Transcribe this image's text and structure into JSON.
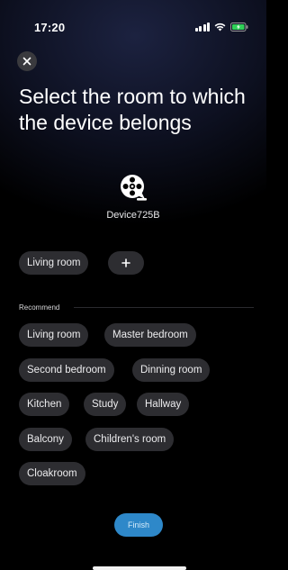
{
  "status_bar": {
    "time": "17:20"
  },
  "header": {
    "close_icon": "close-icon",
    "title": "Select the room to which the device belongs"
  },
  "device": {
    "icon": "device-reel-icon",
    "name": "Device725B"
  },
  "selected_rooms": {
    "items": [
      "Living room"
    ],
    "add_icon": "plus-icon"
  },
  "recommend": {
    "label": "Recommend",
    "rooms": [
      "Living room",
      "Master bedroom",
      "Second bedroom",
      "Dinning room",
      "Kitchen",
      "Study",
      "Hallway",
      "Balcony",
      "Children's room",
      "Cloakroom"
    ]
  },
  "footer": {
    "finish_label": "Finish"
  },
  "colors": {
    "accent": "#2e88c9",
    "chip_background": "#2d2d31",
    "battery_charging": "#30d158"
  }
}
